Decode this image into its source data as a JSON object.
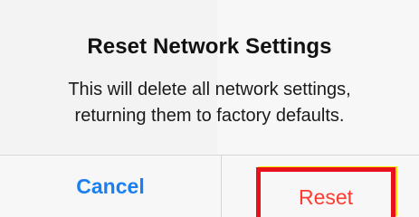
{
  "alert": {
    "title": "Reset Network Settings",
    "message_line_1": "This will delete all network settings,",
    "message_line_2": "returning them to factory defaults.",
    "cancel_label": "Cancel",
    "reset_label": "Reset"
  },
  "colors": {
    "cancel": "#1a7ff0",
    "destructive": "#ff3b30",
    "highlight_border": "#e8101a",
    "highlight_outline": "#f2e600"
  }
}
